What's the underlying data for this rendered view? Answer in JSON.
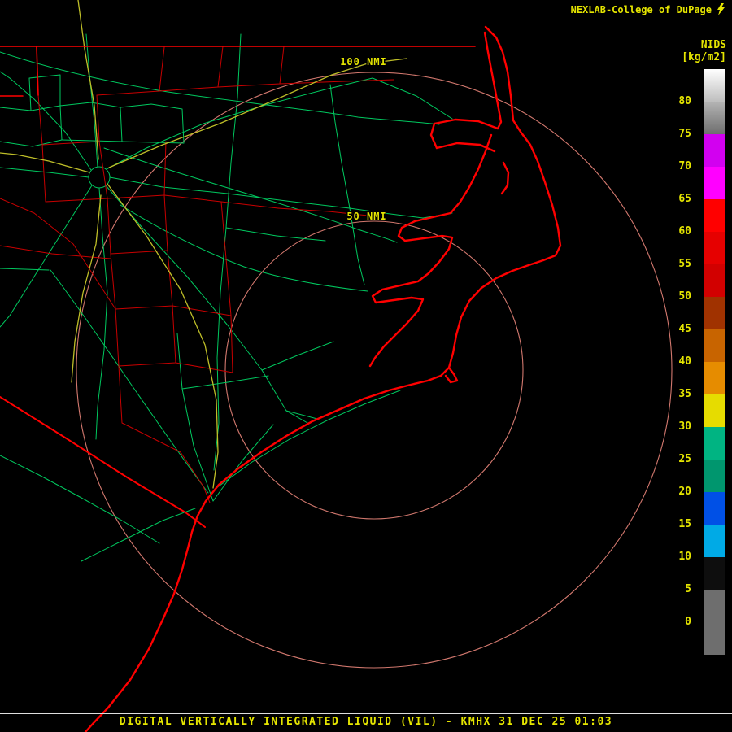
{
  "header": {
    "brand": "NEXLAB-College of DuPage"
  },
  "product_panel": {
    "name": "NIDS",
    "units": "[kg/m2]"
  },
  "range_rings": {
    "outer_label": "100 NMI",
    "inner_label": "50 NMI"
  },
  "footer": {
    "title": "DIGITAL VERTICALLY INTEGRATED LIQUID (VIL) - KMHX 31 DEC 25 01:03"
  },
  "colorbar": {
    "tick_labels": [
      "80",
      "75",
      "70",
      "65",
      "60",
      "55",
      "50",
      "45",
      "40",
      "35",
      "30",
      "25",
      "20",
      "15",
      "10",
      "5",
      "0"
    ],
    "segments": [
      {
        "range": "80-85",
        "color": "#FFFFFF",
        "color2": "#BEBEBE"
      },
      {
        "range": "75-80",
        "color": "#B4B4B4",
        "color2": "#6E6E6E"
      },
      {
        "range": "70-75",
        "color": "#D200F0"
      },
      {
        "range": "65-70",
        "color": "#FF00FF"
      },
      {
        "range": "60-65",
        "color": "#FF0000"
      },
      {
        "range": "55-60",
        "color": "#E60000"
      },
      {
        "range": "50-55",
        "color": "#D20000"
      },
      {
        "range": "45-50",
        "color": "#A03200"
      },
      {
        "range": "40-45",
        "color": "#C86400"
      },
      {
        "range": "35-40",
        "color": "#E68C00"
      },
      {
        "range": "30-35",
        "color": "#E6DC00"
      },
      {
        "range": "25-30",
        "color": "#00B482"
      },
      {
        "range": "20-25",
        "color": "#00966E"
      },
      {
        "range": "15-20",
        "color": "#0050E6"
      },
      {
        "range": "10-15",
        "color": "#00AAE6"
      },
      {
        "range": "5-10",
        "color": "#0E0E0E"
      },
      {
        "range": "0-5",
        "color": "#6E6E6E"
      },
      {
        "range": "below-0",
        "color": "#6E6E6E"
      }
    ]
  },
  "colors": {
    "background": "#000000",
    "divider": "#DEDEDE",
    "text_yellow": "#E5E500",
    "map_red": "#FF0000",
    "map_red_thin": "#C80000",
    "map_green": "#00C85F",
    "map_yellow": "#BEBE28",
    "range_ring": "#D2786E"
  }
}
